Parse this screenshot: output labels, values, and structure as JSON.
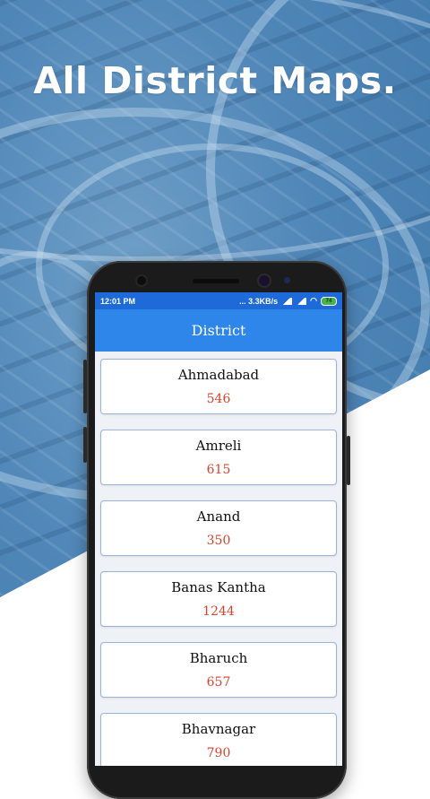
{
  "promo": {
    "headline": "All District Maps."
  },
  "status_bar": {
    "time": "12:01 PM",
    "speed": "... 3.3KB/s",
    "battery": "74"
  },
  "app_bar": {
    "title": "District"
  },
  "districts": [
    {
      "name": "Ahmadabad",
      "count": "546"
    },
    {
      "name": "Amreli",
      "count": "615"
    },
    {
      "name": "Anand",
      "count": "350"
    },
    {
      "name": "Banas Kantha",
      "count": "1244"
    },
    {
      "name": "Bharuch",
      "count": "657"
    },
    {
      "name": "Bhavnagar",
      "count": "790"
    }
  ],
  "colors": {
    "status_bar": "#1d6ad8",
    "app_bar": "#2f86ea",
    "count_text": "#d9432e",
    "card_border": "#9ab5d8"
  }
}
